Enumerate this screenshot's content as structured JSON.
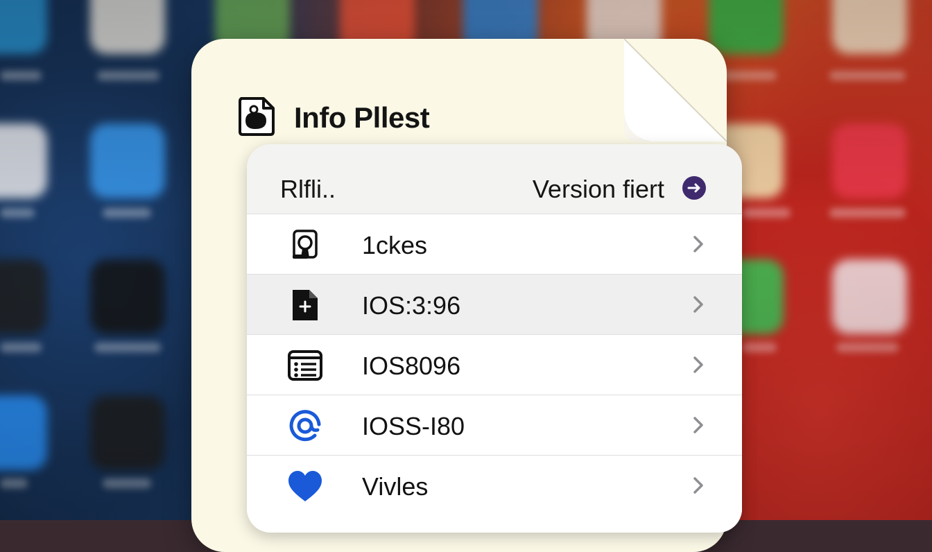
{
  "note": {
    "title": "Info Pllest",
    "title_icon": "document-app-icon"
  },
  "panel": {
    "header_left": "Rlfli..",
    "header_right": "Version fiert",
    "header_button_icon": "arrow-right-circle-icon",
    "rows": [
      {
        "label": "1ckes",
        "icon": "badge-person-icon",
        "selected": false
      },
      {
        "label": "IOS:3:96",
        "icon": "document-plus-icon",
        "selected": true
      },
      {
        "label": "IOS8096",
        "icon": "list-card-icon",
        "selected": false
      },
      {
        "label": "IOSS-I80",
        "icon": "at-sign-icon",
        "selected": false
      },
      {
        "label": "Vivles",
        "icon": "heart-icon",
        "selected": false
      }
    ]
  },
  "colors": {
    "paper": "#fbf8e6",
    "panel": "#ffffff",
    "accent_button": "#3f2a6e",
    "blue_icon": "#1a5ad8"
  }
}
